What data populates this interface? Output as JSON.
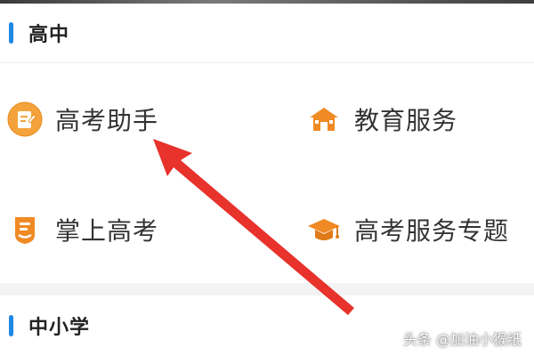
{
  "sections": [
    {
      "title": "高中",
      "items": [
        {
          "label": "高考助手",
          "icon": "notepad-icon"
        },
        {
          "label": "教育服务",
          "icon": "school-house-icon"
        },
        {
          "label": "掌上高考",
          "icon": "mobile-exam-icon"
        },
        {
          "label": "高考服务专题",
          "icon": "graduation-cap-icon"
        }
      ]
    },
    {
      "title": "中小学",
      "items": []
    }
  ],
  "watermark": "头条 @加油小猴纸",
  "colors": {
    "accent_blue": "#1e88e5",
    "icon_orange": "#f08a24",
    "arrow_red": "#e8322c",
    "band_gray": "#f3f3f3"
  }
}
